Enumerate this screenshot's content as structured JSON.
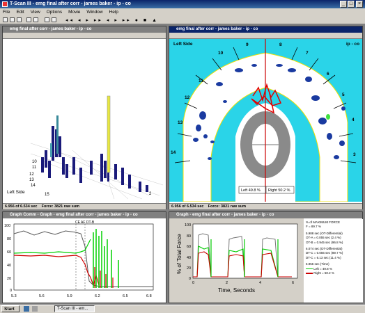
{
  "app": {
    "title": "T-Scan III - emg final after corr - james  baker - ip - co"
  },
  "menu": [
    "File",
    "Edit",
    "View",
    "Options",
    "Movie",
    "Window",
    "Help"
  ],
  "windows": {
    "view3d": {
      "title": "emg final after corr - james  baker - ip - co",
      "side_label": "Left Side",
      "status_time": "6.956 of 6.534 sec",
      "status_force": "Force: 3821 raw sum",
      "teeth_labels": [
        "10",
        "11",
        "12",
        "13",
        "14",
        "15",
        "2"
      ]
    },
    "view2d": {
      "title": "emg final after corr - james  baker - ip - co",
      "left_label": "Left Side",
      "right_label": "ip - co",
      "left_pct": "Left 49.8 %",
      "right_pct": "Right 50.2 %",
      "status_time": "6.956 of 6.534 sec",
      "status_force": "Force: 3821 raw sum",
      "tooth_numbers": [
        "9",
        "10",
        "11",
        "12",
        "13",
        "14",
        "8",
        "7",
        "6",
        "5",
        "4",
        "3"
      ]
    },
    "graph_comm": {
      "title": "Graph Comm - Graph - emg final after corr - james  baker - ip - co",
      "xticks": [
        "5.3",
        "5.6",
        "5.9",
        "6.2",
        "6.5",
        "6.8"
      ],
      "yticks": [
        "100",
        "80",
        "60",
        "40",
        "20",
        "0"
      ],
      "marker": "CE  AF  DT-B"
    },
    "graph": {
      "title": "Graph - emg final after corr - james  baker - ip - co",
      "ylabel": "% of Total Force",
      "xlabel": "Time, Seconds",
      "xticks": [
        "0",
        "2",
        "4",
        "6"
      ],
      "yticks": [
        "100",
        "80",
        "60",
        "40",
        "20",
        "0"
      ],
      "legend": [
        "% of MAXIMUM FORCE",
        "F = 89.7 %",
        "5.988 sec (OT-Differential)",
        "OT-A = 0.055 sec (2.4 %)",
        "OT-B = 0.945 sec (96.8 %)",
        "6.074 sec (DT-Differential)",
        "DT-C = 0.056 sec (89.7 %)",
        "DT-C = 6.13 sec (11.4 %)",
        "6.956 sec (Time)"
      ],
      "series": [
        {
          "name": "Left = 49.8 %",
          "color": "#00cc00"
        },
        {
          "name": "Right = 50.2 %",
          "color": "#cc0000"
        }
      ]
    }
  },
  "taskbar": {
    "start": "Start",
    "item": "T-Scan III - em..."
  }
}
